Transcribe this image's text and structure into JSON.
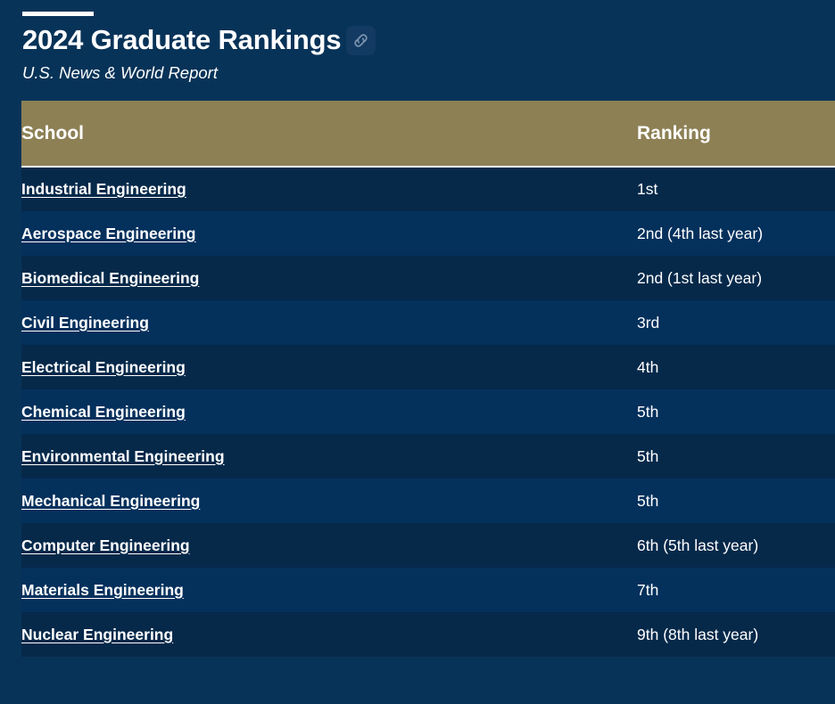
{
  "header": {
    "title": "2024 Graduate Rankings",
    "subtitle": "U.S. News & World Report",
    "anchor_icon": "link-icon"
  },
  "table": {
    "columns": {
      "school": "School",
      "ranking": "Ranking"
    },
    "rows": [
      {
        "school": "Industrial Engineering",
        "ranking": "1st"
      },
      {
        "school": "Aerospace Engineering",
        "ranking": "2nd (4th last year)"
      },
      {
        "school": "Biomedical Engineering",
        "ranking": "2nd (1st last year)"
      },
      {
        "school": "Civil Engineering",
        "ranking": "3rd"
      },
      {
        "school": "Electrical Engineering",
        "ranking": "4th"
      },
      {
        "school": "Chemical Engineering",
        "ranking": "5th"
      },
      {
        "school": "Environmental Engineering",
        "ranking": "5th"
      },
      {
        "school": "Mechanical Engineering",
        "ranking": "5th"
      },
      {
        "school": "Computer Engineering",
        "ranking": "6th (5th last year)"
      },
      {
        "school": "Materials Engineering",
        "ranking": "7th"
      },
      {
        "school": "Nuclear Engineering",
        "ranking": "9th (8th last year)"
      }
    ]
  },
  "colors": {
    "page_background": "#083358",
    "header_bar": "#8d8055",
    "row_dark": "#06294a",
    "row_light": "#04305c",
    "text": "#ffffff",
    "anchor_chip": "#123a62"
  }
}
